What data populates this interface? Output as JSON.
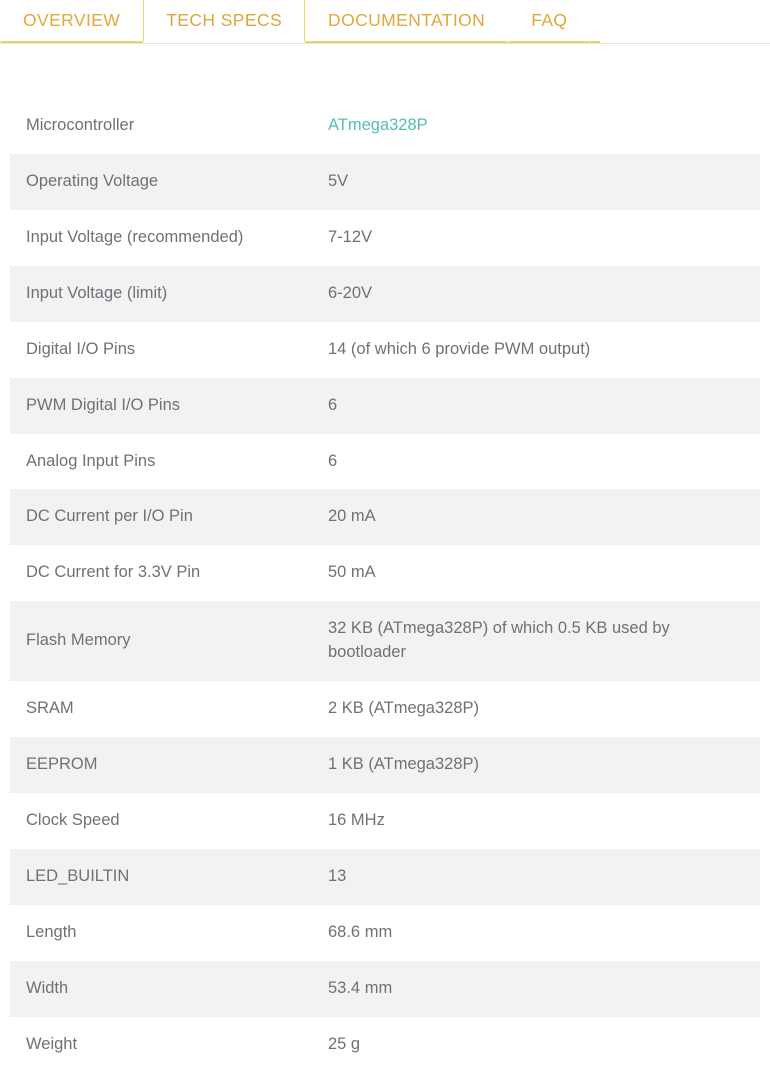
{
  "tabs": [
    {
      "label": "OVERVIEW",
      "active": false
    },
    {
      "label": "TECH SPECS",
      "active": true
    },
    {
      "label": "DOCUMENTATION",
      "active": false
    },
    {
      "label": "FAQ",
      "active": false
    }
  ],
  "colors": {
    "tab_text": "#e3a83a",
    "tab_border": "#e8d56a",
    "row_alt_background": "#f2f2f2",
    "row_background": "#ffffff",
    "text": "#6d7278",
    "link": "#57bdb4",
    "rule": "#e4e4e4"
  },
  "specs": {
    "rows": [
      {
        "key": "Microcontroller",
        "value": "ATmega328P",
        "is_link": true
      },
      {
        "key": "Operating Voltage",
        "value": "5V",
        "is_link": false
      },
      {
        "key": "Input Voltage (recommended)",
        "value": "7-12V",
        "is_link": false
      },
      {
        "key": "Input Voltage (limit)",
        "value": "6-20V",
        "is_link": false
      },
      {
        "key": "Digital I/O Pins",
        "value": "14 (of which 6 provide PWM output)",
        "is_link": false
      },
      {
        "key": "PWM Digital I/O Pins",
        "value": "6",
        "is_link": false
      },
      {
        "key": "Analog Input Pins",
        "value": "6",
        "is_link": false
      },
      {
        "key": "DC Current per I/O Pin",
        "value": "20 mA",
        "is_link": false
      },
      {
        "key": "DC Current for 3.3V Pin",
        "value": "50 mA",
        "is_link": false
      },
      {
        "key": "Flash Memory",
        "value": "32 KB (ATmega328P) of which 0.5 KB used by bootloader",
        "is_link": false
      },
      {
        "key": "SRAM",
        "value": "2 KB (ATmega328P)",
        "is_link": false
      },
      {
        "key": "EEPROM",
        "value": "1 KB (ATmega328P)",
        "is_link": false
      },
      {
        "key": "Clock Speed",
        "value": "16 MHz",
        "is_link": false
      },
      {
        "key": "LED_BUILTIN",
        "value": "13",
        "is_link": false
      },
      {
        "key": "Length",
        "value": "68.6 mm",
        "is_link": false
      },
      {
        "key": "Width",
        "value": "53.4 mm",
        "is_link": false
      },
      {
        "key": "Weight",
        "value": "25 g",
        "is_link": false
      }
    ]
  }
}
